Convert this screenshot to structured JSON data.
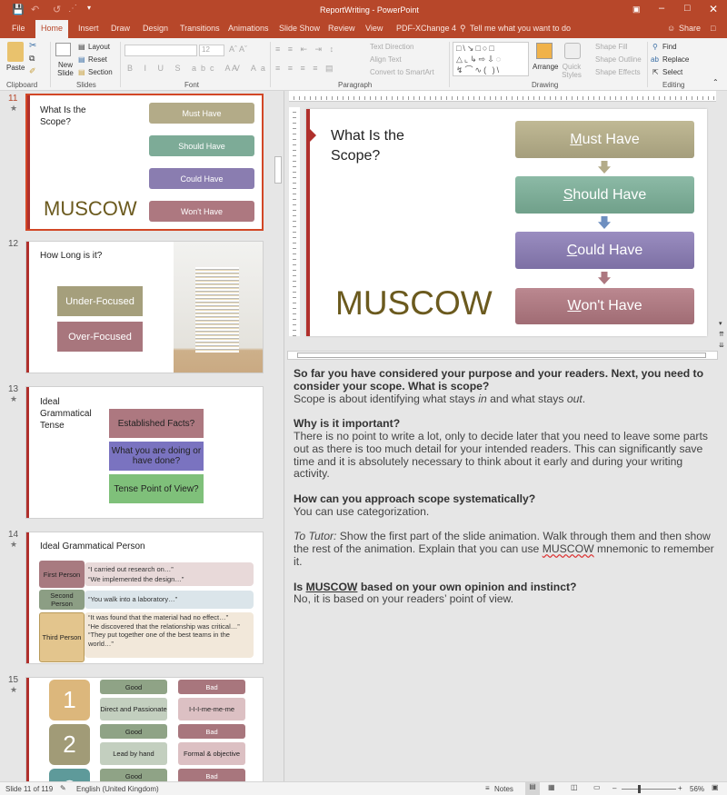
{
  "window": {
    "title": "ReportWriting - PowerPoint",
    "controls": [
      "ribbon-display",
      "minimize",
      "maximize",
      "close"
    ]
  },
  "qat": {
    "save": "save-icon",
    "undo": "undo-icon",
    "redo": "redo-icon"
  },
  "tabs": [
    "File",
    "Home",
    "Insert",
    "Draw",
    "Design",
    "Transitions",
    "Animations",
    "Slide Show",
    "Review",
    "View",
    "PDF-XChange 4"
  ],
  "active_tab": "Home",
  "tell_me": "Tell me what you want to do",
  "share": "Share",
  "ribbon": {
    "clipboard": {
      "label": "Clipboard",
      "paste": "Paste"
    },
    "slides": {
      "label": "Slides",
      "new_slide": "New Slide",
      "layout": "Layout",
      "reset": "Reset",
      "section": "Section"
    },
    "font": {
      "label": "Font",
      "font_name": "",
      "font_size": "12"
    },
    "paragraph": {
      "label": "Paragraph",
      "text_direction": "Text Direction",
      "align_text": "Align Text",
      "convert": "Convert to SmartArt"
    },
    "drawing": {
      "label": "Drawing",
      "arrange": "Arrange",
      "quick_styles": "Quick Styles",
      "shape_fill": "Shape Fill",
      "shape_outline": "Shape Outline",
      "shape_effects": "Shape Effects"
    },
    "editing": {
      "label": "Editing",
      "find": "Find",
      "replace": "Replace",
      "select": "Select"
    }
  },
  "thumbnails": [
    {
      "num": "11",
      "title": "What Is the Scope?",
      "boxes": [
        "Must Have",
        "Should Have",
        "Could Have",
        "Won't Have"
      ],
      "big": "MUSCOW"
    },
    {
      "num": "12",
      "title": "How Long is it?",
      "boxes": [
        "Under-Focused",
        "Over-Focused"
      ]
    },
    {
      "num": "13",
      "title": "Ideal Grammatical Tense",
      "boxes": [
        "Established Facts?",
        "What you are doing or have done?",
        "Tense Point of View?"
      ]
    },
    {
      "num": "14",
      "title": "Ideal Grammatical Person",
      "rows": [
        {
          "label": "First Person",
          "items": [
            "“I carried out research on…”",
            "“We implemented the design…”"
          ]
        },
        {
          "label": "Second Person",
          "items": [
            "“You walk into a laboratory…”"
          ]
        },
        {
          "label": "Third Person",
          "items": [
            "“It was found that the material had no effect…”",
            "“He discovered that the relationship was critical…”",
            "“They put together one of the best teams in the world…”"
          ]
        }
      ]
    },
    {
      "num": "15",
      "numbers": [
        "1",
        "2",
        "3"
      ],
      "good": [
        "Good",
        "Good",
        "Good"
      ],
      "bad": [
        "Bad",
        "Bad",
        "Bad"
      ],
      "good_desc": [
        "Direct and Passionate",
        "Lead by hand"
      ],
      "bad_desc": [
        "I-I-I-me-me-me",
        "Formal & objective"
      ]
    }
  ],
  "slide": {
    "title": "What Is the Scope?",
    "boxes": [
      {
        "first": "M",
        "rest": "ust Have"
      },
      {
        "first": "S",
        "rest": "hould Have"
      },
      {
        "first": "C",
        "rest": "ould Have"
      },
      {
        "first": "W",
        "rest": "on't Have"
      }
    ],
    "big": "MUSCOW"
  },
  "notes": {
    "p1_bold": "So far you have considered your purpose and your readers. Next, you need to consider your scope. What is scope?",
    "p1_a": "Scope is about identifying what stays ",
    "p1_in": "in",
    "p1_b": " and what stays ",
    "p1_out": "out",
    "p1_c": ".",
    "p2_bold": "Why is it important?",
    "p2": "There is no point to write a lot, only to decide later that you need to leave some parts out as there is too much detail for your intended readers. This can significantly save time and it is absolutely necessary to think about it early and during your writing activity.",
    "p3_bold": "How can you approach scope systematically?",
    "p3": "You can use categorization.",
    "p4_italic": "To Tutor:",
    "p4_a": " Show the first part of the slide animation. Walk through them and then show the rest of the animation. Explain that you can use ",
    "p4_muscow": "MUSCOW",
    "p4_b": " mnemonic to remember it.",
    "p5_bold_a": "Is ",
    "p5_muscow": "MUSCOW",
    "p5_bold_b": " based on your own opinion and instinct?",
    "p5": "No, it is based on your readers’ point of view."
  },
  "status": {
    "slide": "Slide 11 of 119",
    "language": "English (United Kingdom)",
    "notes": "Notes",
    "zoom": "56%",
    "zoom_fraction": 0.3
  },
  "colors": {
    "accent": "#b7472a",
    "must": "#b3ab88",
    "should": "#7dab97",
    "could": "#8a7db0",
    "wont": "#ad7880",
    "muscow": "#6b5a1e"
  }
}
